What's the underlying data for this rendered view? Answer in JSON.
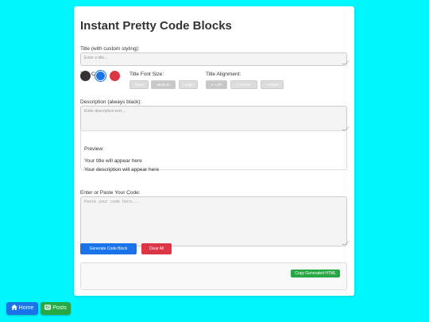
{
  "page": {
    "title": "Instant Pretty Code Blocks"
  },
  "title_field": {
    "label": "Title (with custom styling):",
    "placeholder": "Enter a title..."
  },
  "title_color": {
    "label": "Title Color:",
    "swatches": [
      {
        "name": "black",
        "color": "#333333"
      },
      {
        "name": "blue",
        "color": "#1a73e8"
      },
      {
        "name": "red",
        "color": "#dc3545"
      }
    ]
  },
  "font_size": {
    "label": "Title Font Size:",
    "options": [
      "Small",
      "Medium",
      "Large"
    ],
    "selected": "Medium"
  },
  "alignment": {
    "label": "Title Alignment:",
    "options": [
      "⇤ Left",
      "≡ Center",
      "⇥ Right"
    ],
    "selected": "⇤ Left"
  },
  "description_field": {
    "label": "Description (always black):",
    "placeholder": "Enter description text..."
  },
  "preview": {
    "label": "Preview:",
    "title": "Your title will appear here",
    "description": "Your description will appear here"
  },
  "code_field": {
    "label": "Enter or Paste Your Code:",
    "placeholder": "Paste your code here..."
  },
  "actions": {
    "generate_label": "Generate Code Block",
    "clear_label": "Clear All",
    "copy_label": "Copy Generated HTML"
  },
  "nav": {
    "home_label": "Home",
    "posts_label": "Posts"
  },
  "colors": {
    "background": "#00f7ff",
    "primary": "#1a73e8",
    "danger": "#dc3545",
    "success": "#28a745"
  }
}
